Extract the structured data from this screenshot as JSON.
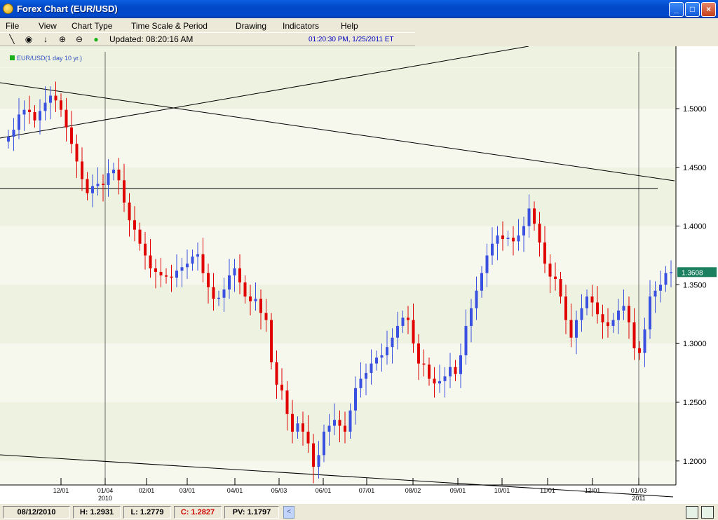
{
  "window": {
    "title": "Forex Chart (EUR/USD)",
    "minimize": "_",
    "maximize": "□",
    "close": "×"
  },
  "menu": {
    "items": [
      "File",
      "View",
      "Chart Type",
      "Time Scale & Period",
      "Drawing",
      "Indicators",
      "Help"
    ]
  },
  "toolbar": {
    "icons": [
      "draw-line-icon",
      "target-icon",
      "arrow-down-icon",
      "zoom-in-icon",
      "zoom-out-icon",
      "status-dot-icon"
    ],
    "updated": "Updated: 08:20:16 AM",
    "clock": "01:20:30 PM, 1/25/2011 ET"
  },
  "legend": {
    "label": "EUR/USD(1 day  10 yr.)",
    "color": "#19b019"
  },
  "colors": {
    "up_candle": "#3a50e0",
    "down_candle": "#e00000",
    "band_light": "#f6f8ee",
    "band_dark": "#eef2e0",
    "price_tag": "#1a8060"
  },
  "chart_data": {
    "type": "candlestick",
    "symbol": "EUR/USD",
    "period": "1 day",
    "range": "10 yr.",
    "last_price": "1.3608",
    "ylim": [
      1.18,
      1.535
    ],
    "y_ticks": [
      "1.5000",
      "1.4500",
      "1.4000",
      "1.3500",
      "1.3000",
      "1.2500",
      "1.2000"
    ],
    "x_ticks": [
      {
        "label": "12/01",
        "year": ""
      },
      {
        "label": "01/04",
        "year": "2010"
      },
      {
        "label": "02/01",
        "year": ""
      },
      {
        "label": "03/01",
        "year": ""
      },
      {
        "label": "04/01",
        "year": ""
      },
      {
        "label": "05/03",
        "year": ""
      },
      {
        "label": "06/01",
        "year": ""
      },
      {
        "label": "07/01",
        "year": ""
      },
      {
        "label": "08/02",
        "year": ""
      },
      {
        "label": "09/01",
        "year": ""
      },
      {
        "label": "10/01",
        "year": ""
      },
      {
        "label": "11/01",
        "year": ""
      },
      {
        "label": "12/01",
        "year": ""
      },
      {
        "label": "01/03",
        "year": "2011"
      }
    ],
    "series_close": [
      [
        0,
        1.476
      ],
      [
        1,
        1.482
      ],
      [
        2,
        1.495
      ],
      [
        3,
        1.499
      ],
      [
        4,
        1.497
      ],
      [
        5,
        1.49
      ],
      [
        6,
        1.498
      ],
      [
        7,
        1.505
      ],
      [
        8,
        1.511
      ],
      [
        9,
        1.507
      ],
      [
        10,
        1.499
      ],
      [
        11,
        1.484
      ],
      [
        12,
        1.47
      ],
      [
        13,
        1.455
      ],
      [
        14,
        1.44
      ],
      [
        15,
        1.428
      ],
      [
        16,
        1.434
      ],
      [
        17,
        1.436
      ],
      [
        18,
        1.435
      ],
      [
        19,
        1.445
      ],
      [
        20,
        1.448
      ],
      [
        21,
        1.439
      ],
      [
        22,
        1.42
      ],
      [
        23,
        1.405
      ],
      [
        24,
        1.397
      ],
      [
        25,
        1.385
      ],
      [
        26,
        1.375
      ],
      [
        27,
        1.364
      ],
      [
        28,
        1.361
      ],
      [
        29,
        1.358
      ],
      [
        30,
        1.357
      ],
      [
        31,
        1.356
      ],
      [
        32,
        1.362
      ],
      [
        33,
        1.365
      ],
      [
        34,
        1.368
      ],
      [
        35,
        1.374
      ],
      [
        36,
        1.376
      ],
      [
        37,
        1.36
      ],
      [
        38,
        1.348
      ],
      [
        39,
        1.338
      ],
      [
        40,
        1.339
      ],
      [
        41,
        1.346
      ],
      [
        42,
        1.358
      ],
      [
        43,
        1.364
      ],
      [
        44,
        1.352
      ],
      [
        45,
        1.34
      ],
      [
        46,
        1.336
      ],
      [
        47,
        1.338
      ],
      [
        48,
        1.326
      ],
      [
        49,
        1.32
      ],
      [
        50,
        1.284
      ],
      [
        51,
        1.265
      ],
      [
        52,
        1.26
      ],
      [
        53,
        1.24
      ],
      [
        54,
        1.225
      ],
      [
        55,
        1.232
      ],
      [
        56,
        1.225
      ],
      [
        57,
        1.215
      ],
      [
        58,
        1.195
      ],
      [
        59,
        1.205
      ],
      [
        60,
        1.225
      ],
      [
        61,
        1.23
      ],
      [
        62,
        1.235
      ],
      [
        63,
        1.23
      ],
      [
        64,
        1.225
      ],
      [
        65,
        1.243
      ],
      [
        66,
        1.262
      ],
      [
        67,
        1.27
      ],
      [
        68,
        1.275
      ],
      [
        69,
        1.283
      ],
      [
        70,
        1.288
      ],
      [
        71,
        1.29
      ],
      [
        72,
        1.297
      ],
      [
        73,
        1.305
      ],
      [
        74,
        1.315
      ],
      [
        75,
        1.322
      ],
      [
        76,
        1.32
      ],
      [
        77,
        1.3
      ],
      [
        78,
        1.283
      ],
      [
        79,
        1.282
      ],
      [
        80,
        1.27
      ],
      [
        81,
        1.266
      ],
      [
        82,
        1.268
      ],
      [
        83,
        1.272
      ],
      [
        84,
        1.28
      ],
      [
        85,
        1.274
      ],
      [
        86,
        1.29
      ],
      [
        87,
        1.315
      ],
      [
        88,
        1.33
      ],
      [
        89,
        1.345
      ],
      [
        90,
        1.36
      ],
      [
        91,
        1.375
      ],
      [
        92,
        1.385
      ],
      [
        93,
        1.392
      ],
      [
        94,
        1.389
      ],
      [
        95,
        1.39
      ],
      [
        96,
        1.387
      ],
      [
        97,
        1.392
      ],
      [
        98,
        1.4
      ],
      [
        99,
        1.415
      ],
      [
        100,
        1.402
      ],
      [
        101,
        1.386
      ],
      [
        102,
        1.368
      ],
      [
        103,
        1.357
      ],
      [
        104,
        1.355
      ],
      [
        105,
        1.34
      ],
      [
        106,
        1.32
      ],
      [
        107,
        1.305
      ],
      [
        108,
        1.32
      ],
      [
        109,
        1.33
      ],
      [
        110,
        1.34
      ],
      [
        111,
        1.335
      ],
      [
        112,
        1.325
      ],
      [
        113,
        1.318
      ],
      [
        114,
        1.315
      ],
      [
        115,
        1.32
      ],
      [
        116,
        1.328
      ],
      [
        117,
        1.332
      ],
      [
        118,
        1.318
      ],
      [
        119,
        1.296
      ],
      [
        120,
        1.292
      ],
      [
        121,
        1.312
      ],
      [
        122,
        1.34
      ],
      [
        123,
        1.345
      ],
      [
        124,
        1.35
      ],
      [
        125,
        1.36
      ],
      [
        126,
        1.3608
      ]
    ]
  },
  "status": {
    "date": "08/12/2010",
    "high": "H: 1.2931",
    "low": "L: 1.2779",
    "close": "C: 1.2827",
    "pv": "PV: 1.1797",
    "scroll_left": "<"
  }
}
